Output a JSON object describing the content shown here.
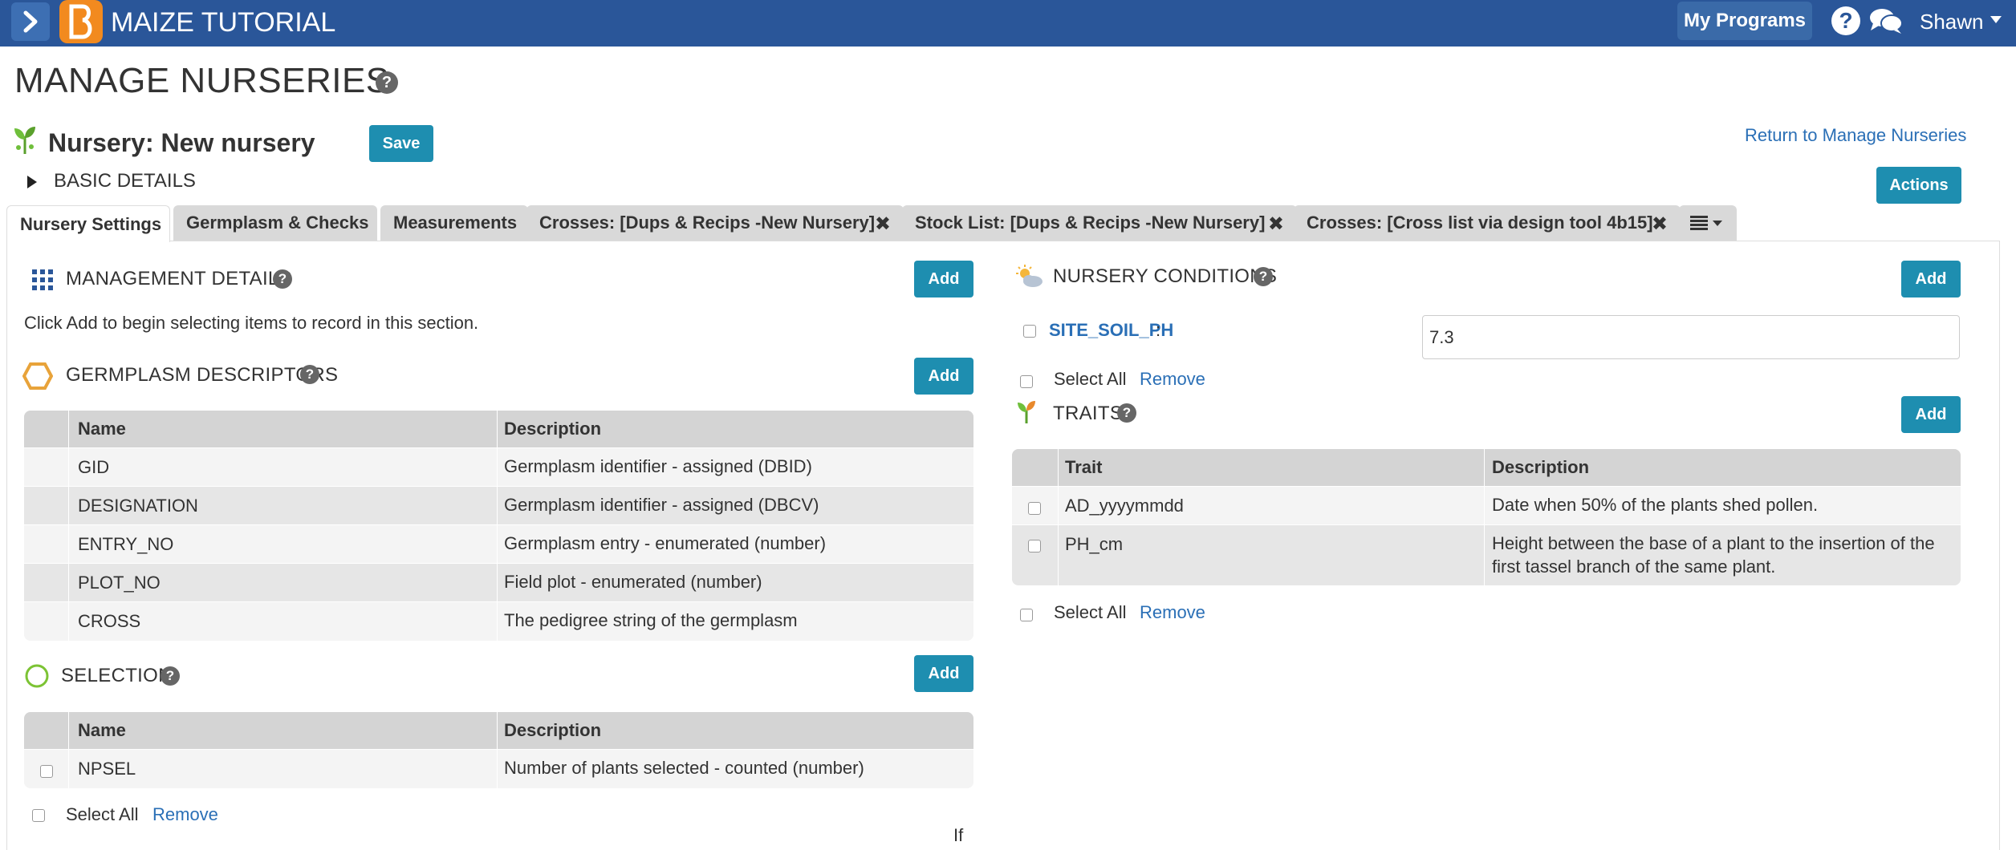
{
  "topbar": {
    "app_title": "MAIZE TUTORIAL",
    "my_programs": "My Programs",
    "user_name": "Shawn",
    "help_icon": "question-circle-icon",
    "chat_icon": "chat-bubbles-icon",
    "menu_icon": "chevron-right-icon"
  },
  "page": {
    "title": "MANAGE NURSERIES",
    "nursery_label": "Nursery: New nursery",
    "save_label": "Save",
    "return_link": "Return to Manage Nurseries",
    "basic_details": "BASIC DETAILS",
    "actions_label": "Actions"
  },
  "tabs": [
    {
      "label": "Nursery Settings",
      "closable": false
    },
    {
      "label": "Germplasm & Checks",
      "closable": false
    },
    {
      "label": "Measurements",
      "closable": false
    },
    {
      "label": "Crosses: [Dups & Recips -New Nursery]",
      "closable": true
    },
    {
      "label": "Stock List: [Dups & Recips -New Nursery]",
      "closable": true
    },
    {
      "label": "Crosses: [Cross list via design tool 4b15]",
      "closable": true
    }
  ],
  "close_glyph": "✖",
  "management": {
    "title": "MANAGEMENT DETAILS",
    "add_label": "Add",
    "hint": "Click Add to begin selecting items to record in this section."
  },
  "germplasm": {
    "title": "GERMPLASM DESCRIPTORS",
    "add_label": "Add",
    "columns": [
      "Name",
      "Description"
    ],
    "rows": [
      {
        "name": "GID",
        "description": "Germplasm identifier - assigned (DBID)"
      },
      {
        "name": "DESIGNATION",
        "description": "Germplasm identifier - assigned (DBCV)"
      },
      {
        "name": "ENTRY_NO",
        "description": "Germplasm entry - enumerated (number)"
      },
      {
        "name": "PLOT_NO",
        "description": "Field plot - enumerated (number)"
      },
      {
        "name": "CROSS",
        "description": "The pedigree string of the germplasm"
      }
    ]
  },
  "selection": {
    "title": "SELECTION",
    "add_label": "Add",
    "columns": [
      "Name",
      "Description"
    ],
    "rows": [
      {
        "name": "NPSEL",
        "description": "Number of plants selected - counted (number)"
      }
    ],
    "select_all": "Select All",
    "remove": "Remove",
    "trailing_text": "If"
  },
  "conditions": {
    "title": "NURSERY CONDITIONS",
    "add_label": "Add",
    "variable": "SITE_SOIL_PH",
    "colon": ":",
    "value": "7.3",
    "select_all": "Select All",
    "remove": "Remove"
  },
  "traits": {
    "title": "TRAITS",
    "add_label": "Add",
    "columns": [
      "Trait",
      "Description"
    ],
    "rows": [
      {
        "name": "AD_yyyymmdd",
        "description": "Date when 50% of the plants shed pollen."
      },
      {
        "name": "PH_cm",
        "description": "Height between the base of a plant to the insertion of the first tassel branch of the same plant."
      }
    ],
    "select_all": "Select All",
    "remove": "Remove"
  },
  "colors": {
    "topbar": "#2a5699",
    "accent_button": "#1e8eb0",
    "link": "#2a6fb6",
    "logo": "#f28a1f"
  }
}
